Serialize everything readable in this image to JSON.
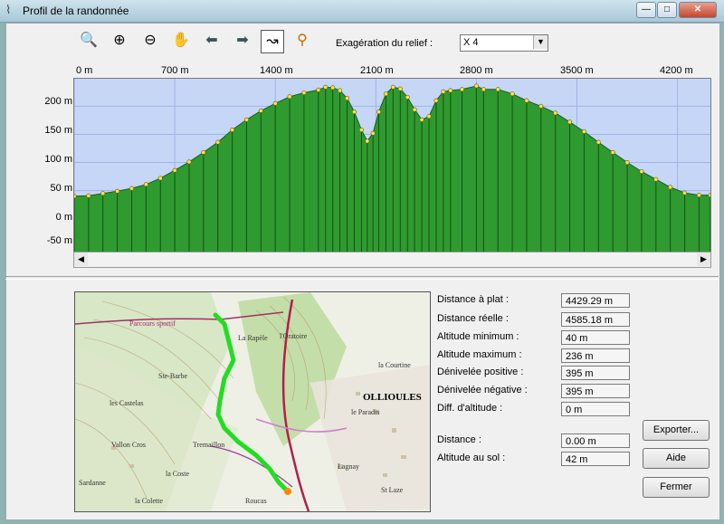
{
  "window": {
    "title": "Profil de la randonnée"
  },
  "titlebar_buttons": {
    "minimize": "—",
    "maximize": "□",
    "close": "✕"
  },
  "toolbar": {
    "tools": [
      {
        "name": "zoom-fit-icon",
        "glyph": "🔍"
      },
      {
        "name": "zoom-in-icon",
        "glyph": "⊕"
      },
      {
        "name": "zoom-out-icon",
        "glyph": "⊖"
      },
      {
        "name": "pan-hand-icon",
        "glyph": "✋"
      },
      {
        "name": "arrow-left-icon",
        "glyph": "⬅"
      },
      {
        "name": "arrow-right-icon",
        "glyph": "➡"
      },
      {
        "name": "profile-mode-icon",
        "glyph": "↝",
        "pressed": true
      },
      {
        "name": "zoom-route-icon",
        "glyph": "⚲"
      }
    ],
    "exaggeration_label": "Exagération du relief :",
    "exaggeration_value": "X 4"
  },
  "chart_data": {
    "type": "area",
    "x_ticks": [
      "0 m",
      "700 m",
      "1400 m",
      "2100 m",
      "2800 m",
      "3500 m",
      "4200 m"
    ],
    "y_ticks": [
      "200 m",
      "150 m",
      "100 m",
      "50 m",
      "0 m",
      "-50 m"
    ],
    "xlim": [
      0,
      4429.29
    ],
    "ylim": [
      -60,
      236
    ],
    "color": "#2f9a2f",
    "background": "#c5d6f7",
    "points": [
      [
        0,
        40
      ],
      [
        100,
        41
      ],
      [
        200,
        45
      ],
      [
        300,
        49
      ],
      [
        400,
        54
      ],
      [
        500,
        61
      ],
      [
        600,
        72
      ],
      [
        700,
        86
      ],
      [
        800,
        101
      ],
      [
        900,
        118
      ],
      [
        1000,
        136
      ],
      [
        1100,
        158
      ],
      [
        1200,
        176
      ],
      [
        1300,
        192
      ],
      [
        1400,
        205
      ],
      [
        1500,
        217
      ],
      [
        1600,
        224
      ],
      [
        1700,
        229
      ],
      [
        1750,
        234
      ],
      [
        1800,
        233
      ],
      [
        1850,
        228
      ],
      [
        1900,
        214
      ],
      [
        1950,
        190
      ],
      [
        2000,
        158
      ],
      [
        2040,
        138
      ],
      [
        2080,
        152
      ],
      [
        2120,
        190
      ],
      [
        2170,
        222
      ],
      [
        2220,
        234
      ],
      [
        2270,
        231
      ],
      [
        2320,
        216
      ],
      [
        2370,
        194
      ],
      [
        2420,
        176
      ],
      [
        2470,
        182
      ],
      [
        2520,
        210
      ],
      [
        2570,
        226
      ],
      [
        2620,
        228
      ],
      [
        2700,
        230
      ],
      [
        2800,
        236
      ],
      [
        2850,
        230
      ],
      [
        2950,
        230
      ],
      [
        3050,
        222
      ],
      [
        3150,
        210
      ],
      [
        3250,
        200
      ],
      [
        3350,
        188
      ],
      [
        3450,
        172
      ],
      [
        3550,
        155
      ],
      [
        3650,
        136
      ],
      [
        3750,
        118
      ],
      [
        3850,
        100
      ],
      [
        3950,
        84
      ],
      [
        4050,
        70
      ],
      [
        4150,
        56
      ],
      [
        4250,
        46
      ],
      [
        4350,
        42
      ],
      [
        4429,
        42
      ]
    ]
  },
  "stats": [
    {
      "label": "Distance à plat :",
      "value": "4429.29 m"
    },
    {
      "label": "Distance réelle :",
      "value": "4585.18 m"
    },
    {
      "label": "Altitude minimum :",
      "value": "40 m"
    },
    {
      "label": "Altitude maximum :",
      "value": "236 m"
    },
    {
      "label": "Dénivelée positive :",
      "value": "395 m"
    },
    {
      "label": "Dénivelée négative :",
      "value": "395 m"
    },
    {
      "label": "Diff. d'altitude :",
      "value": "0 m"
    }
  ],
  "cursor_stats": [
    {
      "label": "Distance :",
      "value": "0.00 m"
    },
    {
      "label": "Altitude au sol :",
      "value": "42 m"
    }
  ],
  "buttons": {
    "export": "Exporter...",
    "help": "Aide",
    "close": "Fermer"
  },
  "map_labels": [
    "Parcours sportif",
    "La Rapèle",
    "l'Oratoire",
    "Ste-Barbe",
    "les Castelas",
    "OLLIOULES",
    "la Courtine",
    "le Paradis",
    "Vallon Cros",
    "Tremaillon",
    "la Coste",
    "Lagnay",
    "St Laze",
    "Roucas",
    "Sardanne",
    "la Colette"
  ],
  "scroll": {
    "left": "◀",
    "right": "▶"
  }
}
